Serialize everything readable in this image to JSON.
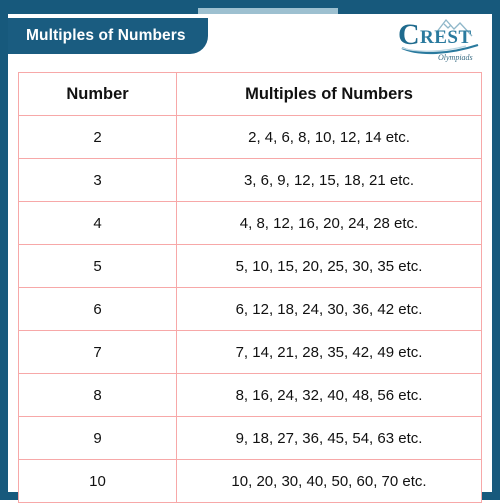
{
  "banner": {
    "title": "Multiples of Numbers"
  },
  "logo": {
    "name": "crest-olympiads-logo",
    "letter": "C",
    "word": "REST",
    "tagline": "Olympiads"
  },
  "table": {
    "headers": [
      "Number",
      "Multiples of Numbers"
    ],
    "rows": [
      {
        "number": "2",
        "multiples": "2, 4, 6, 8, 10, 12, 14 etc."
      },
      {
        "number": "3",
        "multiples": "3, 6, 9, 12, 15, 18, 21 etc."
      },
      {
        "number": "4",
        "multiples": "4, 8, 12, 16, 20, 24, 28 etc."
      },
      {
        "number": "5",
        "multiples": "5, 10, 15, 20, 25, 30, 35 etc."
      },
      {
        "number": "6",
        "multiples": "6, 12, 18, 24, 30, 36, 42 etc."
      },
      {
        "number": "7",
        "multiples": "7, 14, 21, 28, 35, 42, 49 etc."
      },
      {
        "number": "8",
        "multiples": "8, 16, 24, 32, 40, 48, 56 etc."
      },
      {
        "number": "9",
        "multiples": "9, 18, 27, 36, 45, 54, 63 etc."
      },
      {
        "number": "10",
        "multiples": "10, 20, 30, 40, 50, 60, 70 etc."
      }
    ]
  },
  "colors": {
    "frame": "#17597c",
    "banner_bg": "#1a5c80",
    "banner_text": "#ffffff",
    "table_border": "#f7a8a8",
    "text": "#111111",
    "top_bar_light": "#9dc0d0"
  }
}
